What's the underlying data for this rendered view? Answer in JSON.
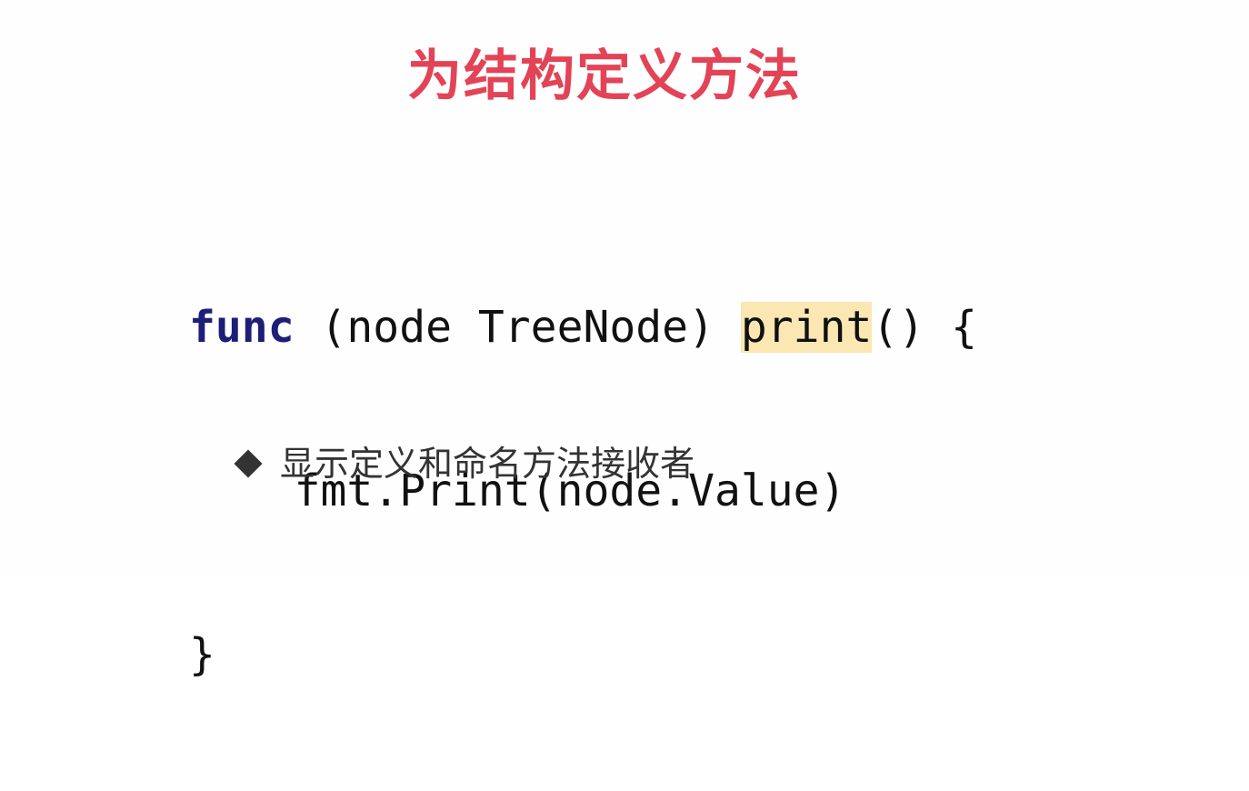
{
  "slide": {
    "title": "为结构定义方法",
    "title_color": "#e34356",
    "code": {
      "line1": {
        "keyword": "func",
        "receiver": " (node TreeNode) ",
        "method": "print",
        "rest": "() {"
      },
      "line2": "    fmt.Print(node.Value)",
      "line3": "}"
    },
    "keyword_color": "#1e1e78",
    "highlight_color": "#fbe7b2",
    "bullet": {
      "icon": "diamond-icon",
      "text": "显示定义和命名方法接收者"
    }
  }
}
